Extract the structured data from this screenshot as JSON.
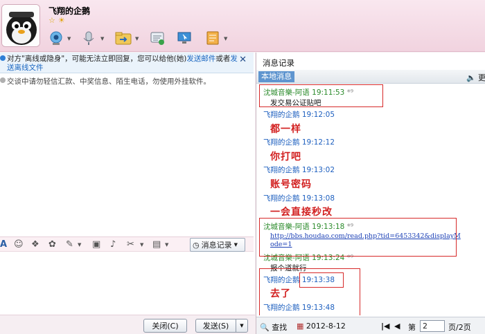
{
  "header": {
    "nickname": "飞翔的企鹅",
    "toolbar": [
      {
        "icon": "video-camera-icon"
      },
      {
        "icon": "microphone-icon"
      },
      {
        "icon": "folder-transfer-icon"
      },
      {
        "icon": "message-plus-icon"
      },
      {
        "icon": "remote-desktop-icon"
      },
      {
        "icon": "app-menu-icon"
      }
    ]
  },
  "left": {
    "notice_prefix": "对方\"离线或隐身\"，可能无法立即回复，您可以给他(她)",
    "notice_link1": "发送邮件",
    "notice_mid": "或者",
    "notice_link2": "发送离线文件",
    "notice_close": "✕",
    "tip": "交谈中请勿轻信汇款、中奖信息、陌生电话，勿使用外挂软件。",
    "history_button": "消息记录",
    "close_button": "关闭(C)",
    "send_button": "发送(S)"
  },
  "right": {
    "title": "消息记录",
    "tab_local": "本地消息",
    "tab_more": "更",
    "messages": [
      {
        "sender": "沈城音樂-阿语",
        "time": "19:11:53",
        "text": "发交易公证贴吧",
        "type": "friend"
      },
      {
        "sender": "飞翔的企鹅",
        "time": "19:12:05",
        "text": "都一样",
        "type": "me"
      },
      {
        "sender": "飞翔的企鹅",
        "time": "19:12:12",
        "text": "你打吧",
        "type": "me"
      },
      {
        "sender": "飞翔的企鹅",
        "time": "19:13:02",
        "text": "账号密码",
        "type": "me"
      },
      {
        "sender": "飞翔的企鹅",
        "time": "19:13:08",
        "text": "一会直接秒改",
        "type": "me"
      },
      {
        "sender": "沈城音樂-阿语",
        "time": "19:13:18",
        "text": "http://bbs.houdao.com/read.php?tid=6453342&displayMode=1",
        "type": "friend"
      },
      {
        "sender": "沈城音樂-阿语",
        "time": "19:13:24",
        "text": "报个道就行",
        "type": "friend"
      },
      {
        "sender": "飞翔的企鹅",
        "time": "19:13:38",
        "text": "去了",
        "type": "me"
      },
      {
        "sender": "飞翔的企鹅",
        "time": "19:13:48",
        "text": "",
        "type": "me"
      }
    ],
    "search_label": "查找",
    "date": "2012-8-12",
    "page_label": "第",
    "page_value": "2",
    "page_total": "页/2页"
  }
}
